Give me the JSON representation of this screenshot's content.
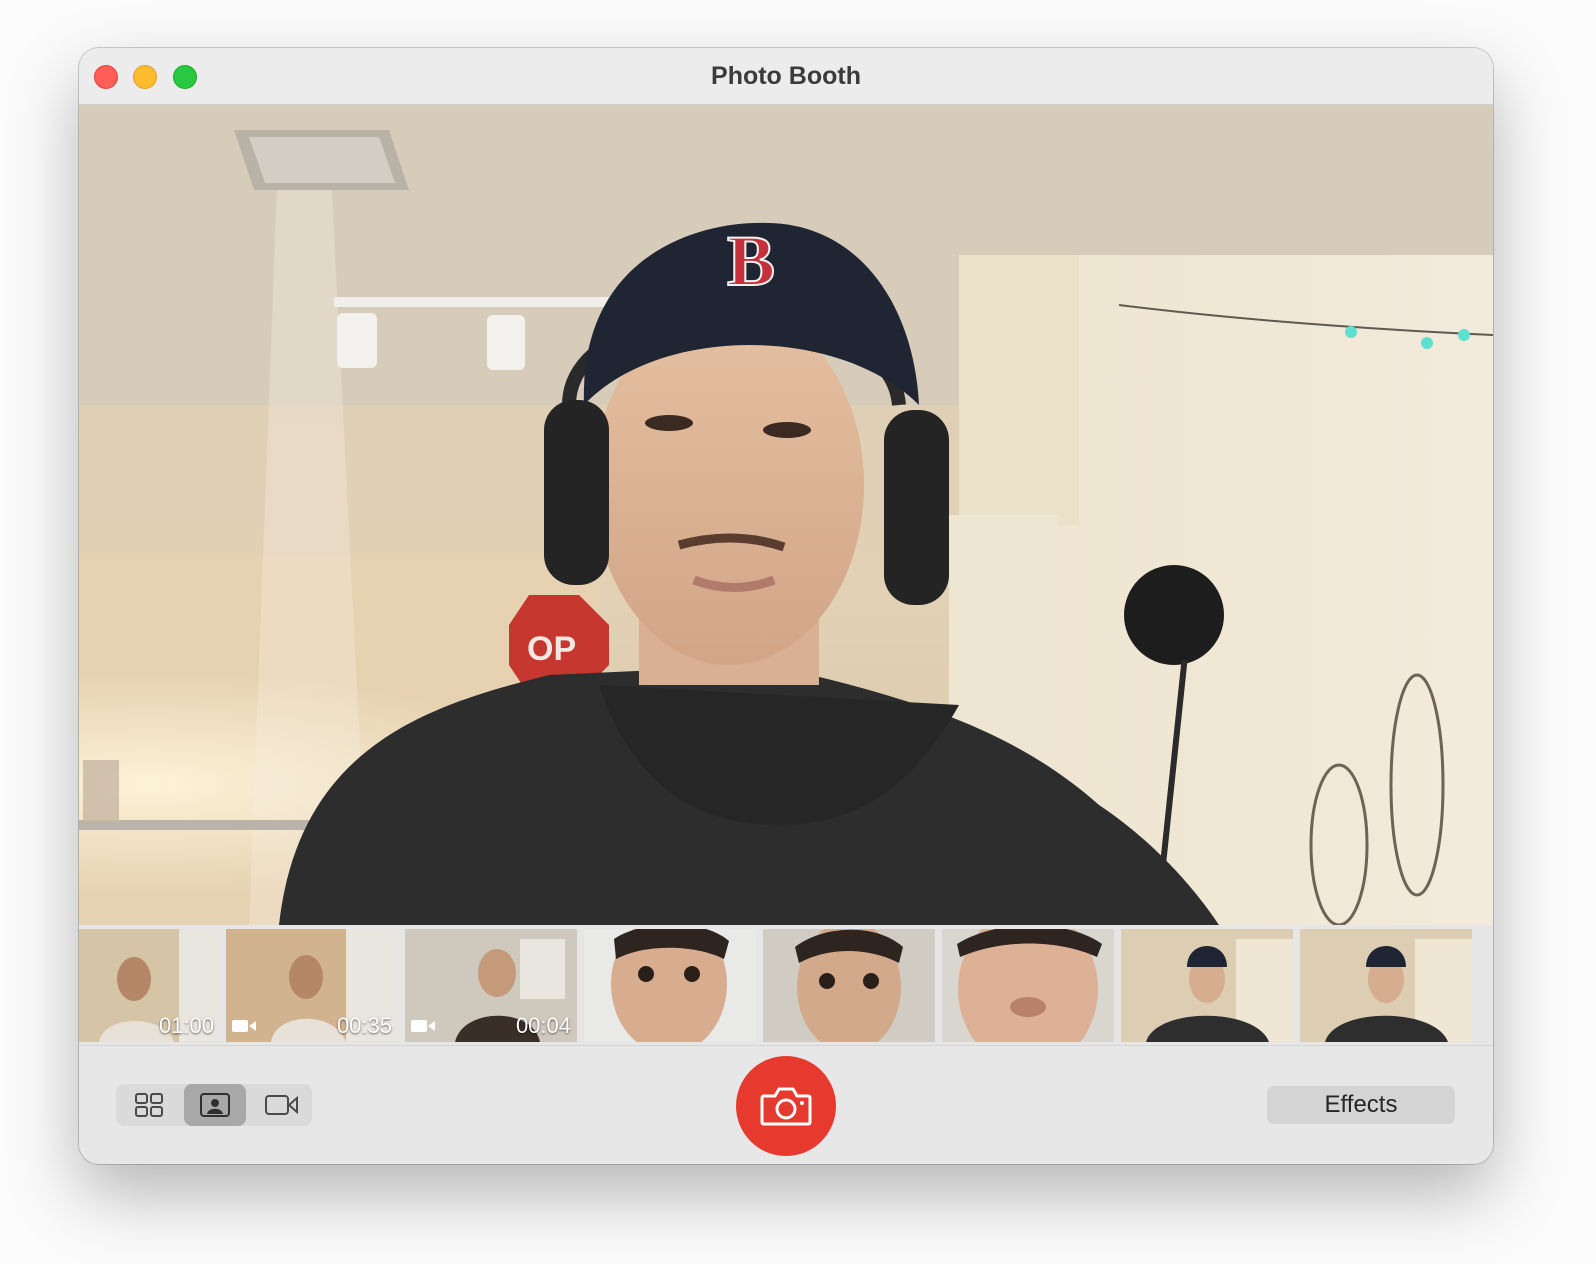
{
  "window": {
    "title": "Photo Booth"
  },
  "traffic_lights": {
    "close_color": "#ff5f57",
    "minimize_color": "#febc2e",
    "zoom_color": "#28c840"
  },
  "viewer": {
    "content": "live-camera-preview",
    "sign_text": "OP"
  },
  "filmstrip": {
    "thumbnails": [
      {
        "type": "video",
        "duration": "01:00"
      },
      {
        "type": "video",
        "duration": "00:35"
      },
      {
        "type": "video",
        "duration": "00:04"
      },
      {
        "type": "photo"
      },
      {
        "type": "photo"
      },
      {
        "type": "photo"
      },
      {
        "type": "photo"
      },
      {
        "type": "photo"
      }
    ]
  },
  "toolbar": {
    "view_modes": [
      {
        "icon": "four-up-grid-icon",
        "active": false
      },
      {
        "icon": "single-photo-icon",
        "active": true
      },
      {
        "icon": "video-camera-icon",
        "active": false
      }
    ],
    "shutter_icon": "camera-icon",
    "shutter_color": "#e63a2e",
    "effects_label": "Effects"
  }
}
